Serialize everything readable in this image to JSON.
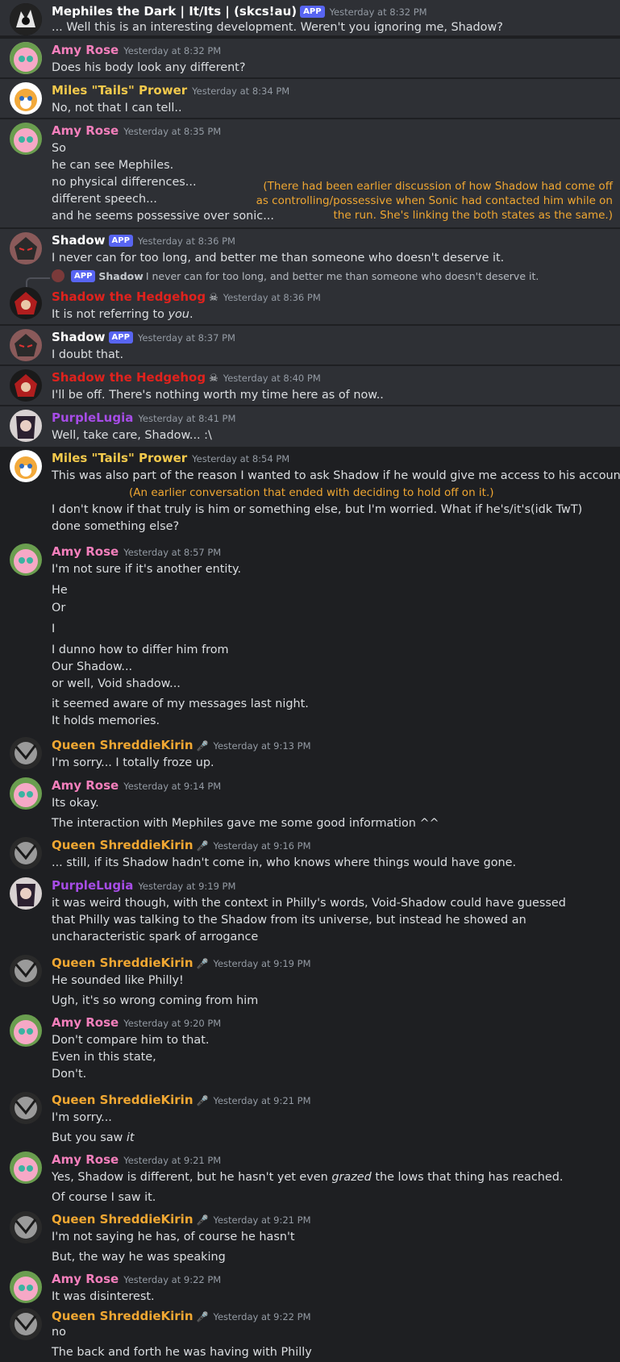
{
  "colors": {
    "background": "#1e1f22",
    "highlight": "#2e3035",
    "amy": "#f47fbc",
    "tails": "#f2c94c",
    "shadow_red": "#e0221d",
    "purple": "#a64ce6",
    "queen": "#f0a732",
    "note": "#f0a732"
  },
  "app_badge": "APP",
  "messages": [
    {
      "author": "Mephiles the Dark | It/Its | (skcs!au)",
      "time": "Yesterday at 8:32 PM",
      "lines": [
        "... Well this is an interesting development. Weren't you ignoring me, Shadow?"
      ]
    },
    {
      "author": "Amy Rose",
      "time": "Yesterday at 8:32 PM",
      "lines": [
        "Does his body look any different?"
      ]
    },
    {
      "author": "Miles \"Tails\" Prower",
      "time": "Yesterday at 8:34 PM",
      "lines": [
        "No, not that I can tell.."
      ]
    },
    {
      "author": "Amy Rose",
      "time": "Yesterday at 8:35 PM",
      "lines": [
        "So",
        "he can see Mephiles.",
        "no physical differences...",
        "different speech...",
        "and he seems possessive over sonic..."
      ]
    },
    {
      "author": "Shadow",
      "time": "Yesterday at 8:36 PM",
      "lines": [
        "I never can for too long, and better me than someone who doesn't deserve it."
      ]
    },
    {
      "author": "Shadow the Hedgehog",
      "time": "Yesterday at 8:36 PM",
      "reply": {
        "name": "Shadow",
        "text": "I never can for too long, and better me than someone who doesn't deserve it."
      },
      "line_pre": "It is not referring to ",
      "line_em": "you",
      "line_post": "."
    },
    {
      "author": "Shadow",
      "time": "Yesterday at 8:37 PM",
      "lines": [
        "I doubt that."
      ]
    },
    {
      "author": "Shadow the Hedgehog",
      "time": "Yesterday at 8:40 PM",
      "lines": [
        "I'll be off. There's nothing worth my time here as of now.."
      ]
    },
    {
      "author": "PurpleLugia",
      "time": "Yesterday at 8:41 PM",
      "lines": [
        "Well, take care, Shadow... :\\"
      ]
    },
    {
      "author": "Miles \"Tails\" Prower",
      "time": "Yesterday at 8:54 PM",
      "lines": [
        "This was also part of the reason I wanted to ask Shadow if he would give me access to his account..",
        "I don't know if that truly is him or something else, but I'm worried. What if he's/it's(idk TwT) done something else?"
      ]
    },
    {
      "author": "Amy Rose",
      "time": "Yesterday at 8:57 PM",
      "lines": [
        "I'm not sure if it's another entity.",
        "He",
        "Or",
        "I",
        "I dunno how to differ him from",
        "Our Shadow...",
        "or well, Void shadow...",
        "it seemed aware of my messages last night.",
        "It holds memories."
      ]
    },
    {
      "author": "Queen ShreddieKirin",
      "time": "Yesterday at 9:13 PM",
      "lines": [
        "I'm sorry... I totally froze up."
      ]
    },
    {
      "author": "Amy Rose",
      "time": "Yesterday at 9:14 PM",
      "lines": [
        "Its okay.",
        "The interaction with Mephiles gave me some good information ^^"
      ]
    },
    {
      "author": "Queen ShreddieKirin",
      "time": "Yesterday at 9:16 PM",
      "lines": [
        "... still, if its Shadow hadn't come in, who knows where things would have gone."
      ]
    },
    {
      "author": "PurpleLugia",
      "time": "Yesterday at 9:19 PM",
      "lines": [
        "it was weird though, with the context in Philly's words, Void-Shadow could have guessed that Philly was talking to the Shadow from its universe, but instead he showed an uncharacteristic spark of arrogance"
      ]
    },
    {
      "author": "Queen ShreddieKirin",
      "time": "Yesterday at 9:19 PM",
      "lines": [
        "He sounded like Philly!",
        "Ugh, it's so wrong coming from him"
      ]
    },
    {
      "author": "Amy Rose",
      "time": "Yesterday at 9:20 PM",
      "lines": [
        "Don't compare him to that.",
        "Even in this state,",
        "Don't."
      ]
    },
    {
      "author": "Queen ShreddieKirin",
      "time": "Yesterday at 9:21 PM",
      "lines": [
        "I'm sorry...",
        "But you saw "
      ],
      "em": "it"
    },
    {
      "author": "Amy Rose",
      "time": "Yesterday at 9:21 PM",
      "line_pre": "Yes, Shadow is different, but he hasn't yet even ",
      "line_em": "grazed",
      "line_post": " the lows that thing has reached.",
      "lines": [
        "Of course I saw it."
      ]
    },
    {
      "author": "Queen ShreddieKirin",
      "time": "Yesterday at 9:21 PM",
      "lines": [
        "I'm not saying he has, of course he hasn't",
        "But, the way he was speaking"
      ]
    },
    {
      "author": "Amy Rose",
      "time": "Yesterday at 9:22 PM",
      "lines": [
        "It was disinterest."
      ]
    },
    {
      "author": "Queen ShreddieKirin",
      "time": "Yesterday at 9:22 PM",
      "lines": [
        "no",
        "The back and forth he was having with Philly"
      ]
    }
  ],
  "notes": {
    "n1": [
      "(There had been earlier discussion of how Shadow had come off",
      "as controlling/possessive when Sonic had contacted him while on",
      "the run. She's linking the both states as the same.)"
    ],
    "n2": "(An earlier conversation that ended with deciding to hold off on it.)"
  }
}
